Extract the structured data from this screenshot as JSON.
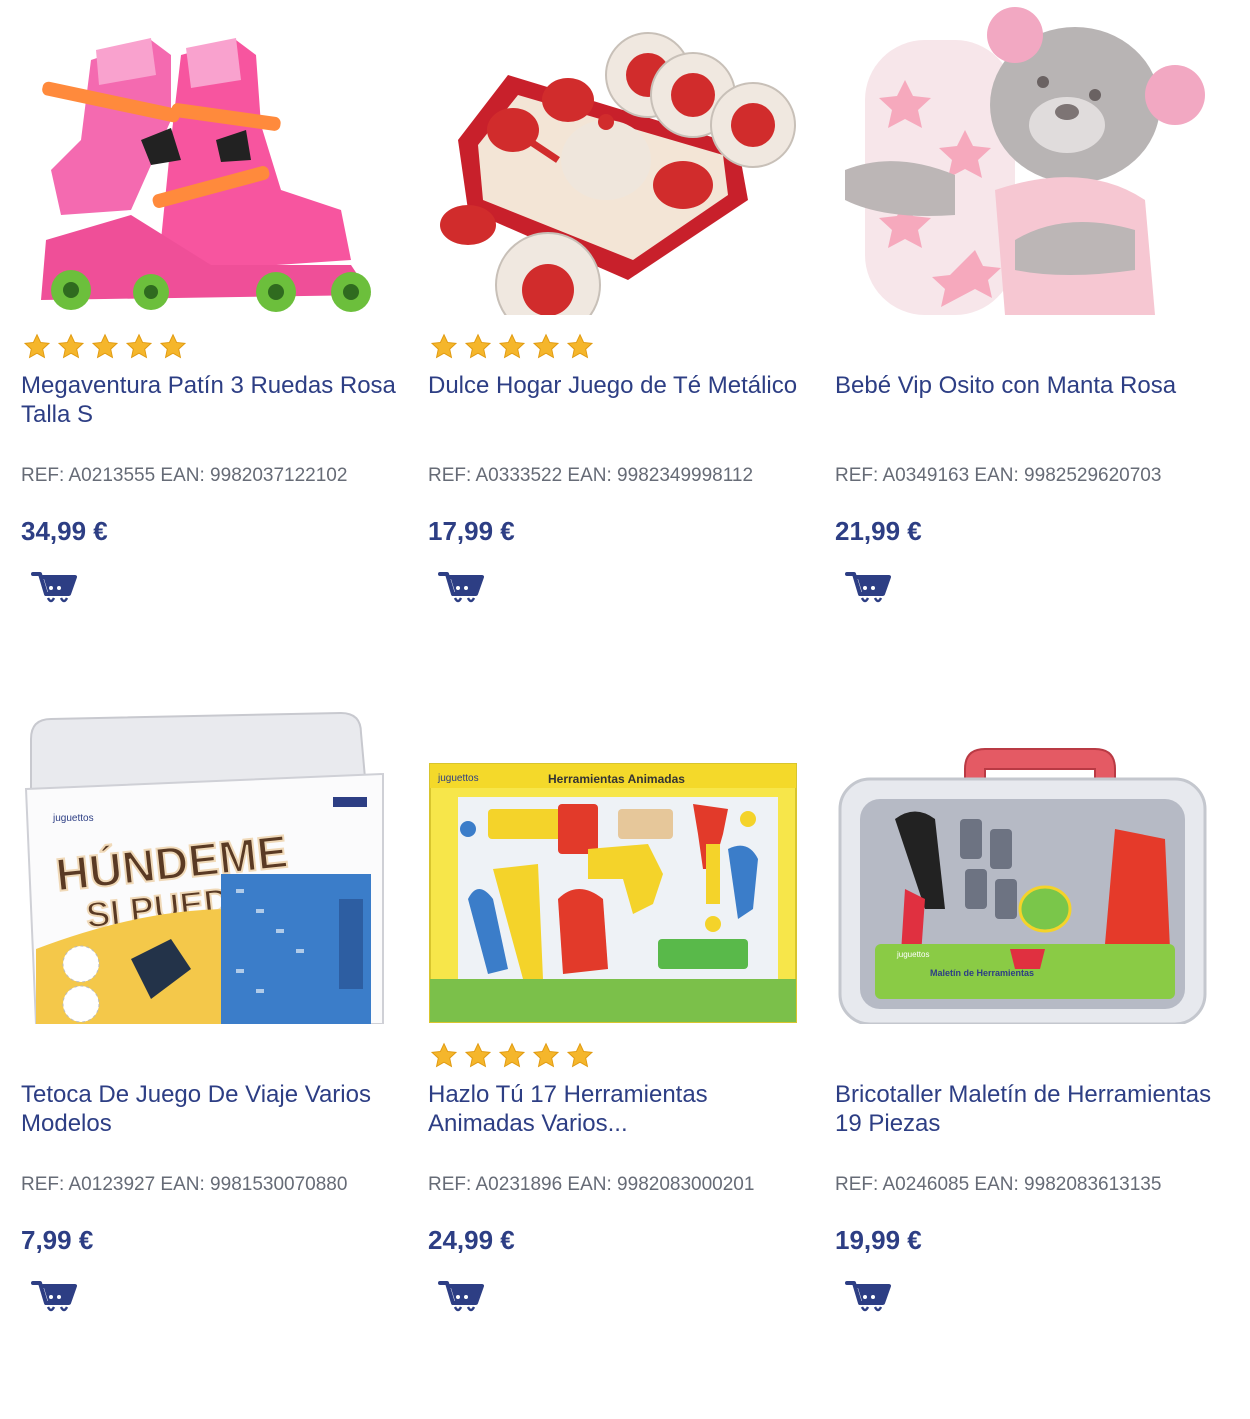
{
  "colors": {
    "title": "#2d3e84",
    "price": "#2d3e84",
    "ref": "#666b76",
    "star": "#f5b62b",
    "cart": "#2d3e84"
  },
  "cart_icon": "shopping-cart-icon",
  "products": [
    {
      "title": "Megaventura Patín 3 Ruedas Rosa Talla S",
      "ref": "REF: A0213555 EAN: 9982037122102",
      "price": "34,99 €",
      "rating": 5,
      "image": "pink-roller-skates"
    },
    {
      "title": "Dulce Hogar Juego de Té Metálico",
      "ref": "REF: A0333522 EAN: 9982349998112",
      "price": "17,99 €",
      "rating": 5,
      "image": "red-tea-set"
    },
    {
      "title": "Bebé Vip Osito con Manta Rosa",
      "ref": "REF: A0349163 EAN: 9982529620703",
      "price": "21,99 €",
      "rating": 0,
      "image": "teddy-bear-blanket"
    },
    {
      "title": "Tetoca De Juego De Viaje Varios Modelos",
      "ref": "REF: A0123927 EAN: 9981530070880",
      "price": "7,99 €",
      "rating": 0,
      "image": "hundeme-si-puedes-game",
      "box_text": [
        "HÚNDEME",
        "SI PUEDES"
      ],
      "brand": "juguettos"
    },
    {
      "title": "Hazlo Tú 17 Herramientas Animadas Varios...",
      "ref": "REF: A0231896 EAN: 9982083000201",
      "price": "24,99 €",
      "rating": 5,
      "image": "animated-tools-set",
      "box_text": [
        "Herramientas Animadas"
      ],
      "brand": "juguettos"
    },
    {
      "title": "Bricotaller Maletín de Herramientas 19 Piezas",
      "ref": "REF: A0246085 EAN: 9982083613135",
      "price": "19,99 €",
      "rating": 0,
      "image": "tool-case",
      "box_text": [
        "Maletín de Herramientas"
      ],
      "brand": "juguettos"
    }
  ]
}
